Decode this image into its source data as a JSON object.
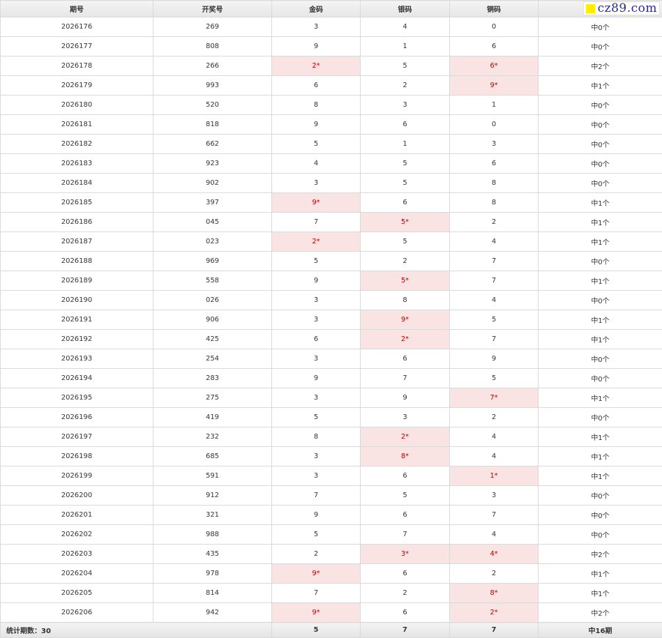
{
  "headers": [
    "期号",
    "开奖号",
    "金码",
    "银码",
    "铜码",
    ""
  ],
  "watermark": {
    "text": "cz89.com",
    "square_color": "#ffee00",
    "text_color": "#2a2a8a"
  },
  "colors": {
    "hit_bg": "#fae3e3",
    "hit_text": "#c00000",
    "header_bg": "#ececec"
  },
  "rows": [
    {
      "period": "2026176",
      "draw": "269",
      "gold": "3",
      "silver": "4",
      "bronze": "0",
      "result": "中0个",
      "hits": [
        false,
        false,
        false
      ]
    },
    {
      "period": "2026177",
      "draw": "808",
      "gold": "9",
      "silver": "1",
      "bronze": "6",
      "result": "中0个",
      "hits": [
        false,
        false,
        false
      ]
    },
    {
      "period": "2026178",
      "draw": "266",
      "gold": "2*",
      "silver": "5",
      "bronze": "6*",
      "result": "中2个",
      "hits": [
        true,
        false,
        true
      ]
    },
    {
      "period": "2026179",
      "draw": "993",
      "gold": "6",
      "silver": "2",
      "bronze": "9*",
      "result": "中1个",
      "hits": [
        false,
        false,
        true
      ]
    },
    {
      "period": "2026180",
      "draw": "520",
      "gold": "8",
      "silver": "3",
      "bronze": "1",
      "result": "中0个",
      "hits": [
        false,
        false,
        false
      ]
    },
    {
      "period": "2026181",
      "draw": "818",
      "gold": "9",
      "silver": "6",
      "bronze": "0",
      "result": "中0个",
      "hits": [
        false,
        false,
        false
      ]
    },
    {
      "period": "2026182",
      "draw": "662",
      "gold": "5",
      "silver": "1",
      "bronze": "3",
      "result": "中0个",
      "hits": [
        false,
        false,
        false
      ]
    },
    {
      "period": "2026183",
      "draw": "923",
      "gold": "4",
      "silver": "5",
      "bronze": "6",
      "result": "中0个",
      "hits": [
        false,
        false,
        false
      ]
    },
    {
      "period": "2026184",
      "draw": "902",
      "gold": "3",
      "silver": "5",
      "bronze": "8",
      "result": "中0个",
      "hits": [
        false,
        false,
        false
      ]
    },
    {
      "period": "2026185",
      "draw": "397",
      "gold": "9*",
      "silver": "6",
      "bronze": "8",
      "result": "中1个",
      "hits": [
        true,
        false,
        false
      ]
    },
    {
      "period": "2026186",
      "draw": "045",
      "gold": "7",
      "silver": "5*",
      "bronze": "2",
      "result": "中1个",
      "hits": [
        false,
        true,
        false
      ]
    },
    {
      "period": "2026187",
      "draw": "023",
      "gold": "2*",
      "silver": "5",
      "bronze": "4",
      "result": "中1个",
      "hits": [
        true,
        false,
        false
      ]
    },
    {
      "period": "2026188",
      "draw": "969",
      "gold": "5",
      "silver": "2",
      "bronze": "7",
      "result": "中0个",
      "hits": [
        false,
        false,
        false
      ]
    },
    {
      "period": "2026189",
      "draw": "558",
      "gold": "9",
      "silver": "5*",
      "bronze": "7",
      "result": "中1个",
      "hits": [
        false,
        true,
        false
      ]
    },
    {
      "period": "2026190",
      "draw": "026",
      "gold": "3",
      "silver": "8",
      "bronze": "4",
      "result": "中0个",
      "hits": [
        false,
        false,
        false
      ]
    },
    {
      "period": "2026191",
      "draw": "906",
      "gold": "3",
      "silver": "9*",
      "bronze": "5",
      "result": "中1个",
      "hits": [
        false,
        true,
        false
      ]
    },
    {
      "period": "2026192",
      "draw": "425",
      "gold": "6",
      "silver": "2*",
      "bronze": "7",
      "result": "中1个",
      "hits": [
        false,
        true,
        false
      ]
    },
    {
      "period": "2026193",
      "draw": "254",
      "gold": "3",
      "silver": "6",
      "bronze": "9",
      "result": "中0个",
      "hits": [
        false,
        false,
        false
      ]
    },
    {
      "period": "2026194",
      "draw": "283",
      "gold": "9",
      "silver": "7",
      "bronze": "5",
      "result": "中0个",
      "hits": [
        false,
        false,
        false
      ]
    },
    {
      "period": "2026195",
      "draw": "275",
      "gold": "3",
      "silver": "9",
      "bronze": "7*",
      "result": "中1个",
      "hits": [
        false,
        false,
        true
      ]
    },
    {
      "period": "2026196",
      "draw": "419",
      "gold": "5",
      "silver": "3",
      "bronze": "2",
      "result": "中0个",
      "hits": [
        false,
        false,
        false
      ]
    },
    {
      "period": "2026197",
      "draw": "232",
      "gold": "8",
      "silver": "2*",
      "bronze": "4",
      "result": "中1个",
      "hits": [
        false,
        true,
        false
      ]
    },
    {
      "period": "2026198",
      "draw": "685",
      "gold": "3",
      "silver": "8*",
      "bronze": "4",
      "result": "中1个",
      "hits": [
        false,
        true,
        false
      ]
    },
    {
      "period": "2026199",
      "draw": "591",
      "gold": "3",
      "silver": "6",
      "bronze": "1*",
      "result": "中1个",
      "hits": [
        false,
        false,
        true
      ]
    },
    {
      "period": "2026200",
      "draw": "912",
      "gold": "7",
      "silver": "5",
      "bronze": "3",
      "result": "中0个",
      "hits": [
        false,
        false,
        false
      ]
    },
    {
      "period": "2026201",
      "draw": "321",
      "gold": "9",
      "silver": "6",
      "bronze": "7",
      "result": "中0个",
      "hits": [
        false,
        false,
        false
      ]
    },
    {
      "period": "2026202",
      "draw": "988",
      "gold": "5",
      "silver": "7",
      "bronze": "4",
      "result": "中0个",
      "hits": [
        false,
        false,
        false
      ]
    },
    {
      "period": "2026203",
      "draw": "435",
      "gold": "2",
      "silver": "3*",
      "bronze": "4*",
      "result": "中2个",
      "hits": [
        false,
        true,
        true
      ]
    },
    {
      "period": "2026204",
      "draw": "978",
      "gold": "9*",
      "silver": "6",
      "bronze": "2",
      "result": "中1个",
      "hits": [
        true,
        false,
        false
      ]
    },
    {
      "period": "2026205",
      "draw": "814",
      "gold": "7",
      "silver": "2",
      "bronze": "8*",
      "result": "中1个",
      "hits": [
        false,
        false,
        true
      ]
    },
    {
      "period": "2026206",
      "draw": "942",
      "gold": "9*",
      "silver": "6",
      "bronze": "2*",
      "result": "中2个",
      "hits": [
        true,
        false,
        true
      ]
    }
  ],
  "footer": {
    "label": "统计期数：30",
    "gold_hits": "5",
    "silver_hits": "7",
    "bronze_hits": "7",
    "total": "中16期"
  }
}
